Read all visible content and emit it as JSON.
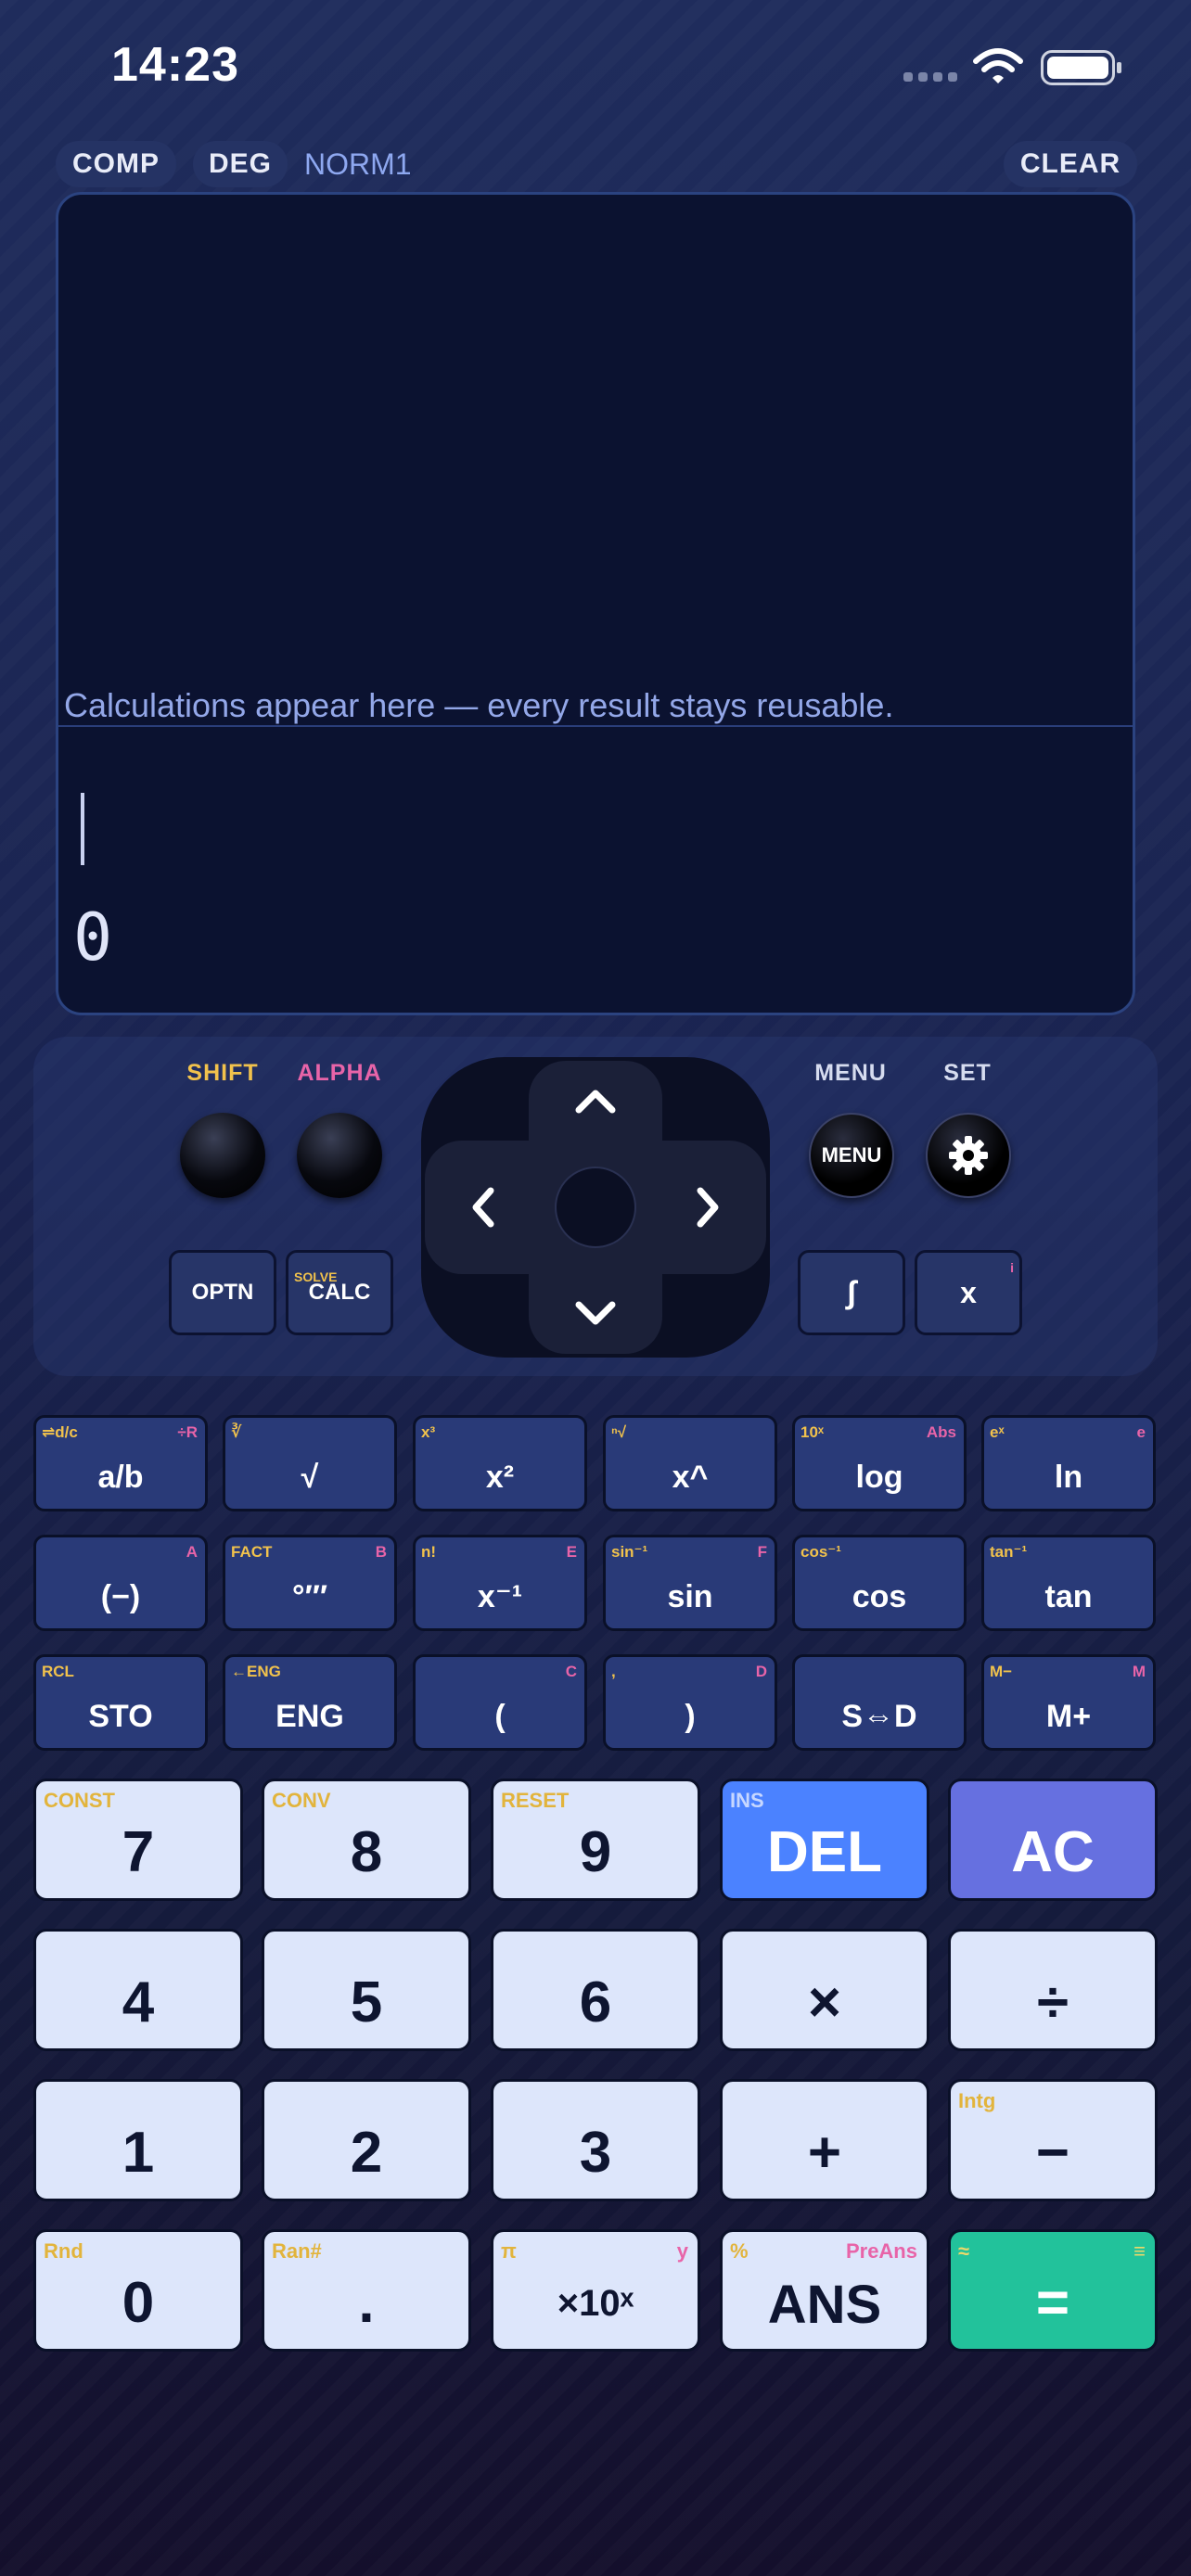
{
  "status_bar": {
    "time": "14:23"
  },
  "modes": {
    "comp": "COMP",
    "deg": "DEG",
    "norm": "NORM1",
    "clear": "CLEAR"
  },
  "display": {
    "placeholder": "Calculations appear here — every result stays reusable.",
    "result": "0"
  },
  "controls": {
    "shift_label": "SHIFT",
    "alpha_label": "ALPHA",
    "menu_label": "MENU",
    "set_label": "SET",
    "menu_button": "MENU",
    "optn": "OPTN",
    "calc": "CALC",
    "calc_shift": "SOLVE",
    "integral": "∫",
    "x": "x",
    "x_alpha": "i",
    "arrows": {
      "up": "⌃",
      "down": "⌄",
      "left": "‹",
      "right": "›"
    }
  },
  "colors": {
    "shift": "#f1c24c",
    "alpha": "#e864a8",
    "del": "#4b82ff",
    "ac": "#6670e0",
    "equals": "#22c29b"
  },
  "function_keys": [
    [
      {
        "label": "a/b",
        "shift": "⇌d/c",
        "alpha": "÷R"
      },
      {
        "label": "√",
        "shift": "∛",
        "alpha": ""
      },
      {
        "label": "x²",
        "shift": "x³",
        "alpha": ""
      },
      {
        "label": "x^",
        "shift": "ⁿ√",
        "alpha": ""
      },
      {
        "label": "log",
        "shift": "10ˣ",
        "alpha": "Abs"
      },
      {
        "label": "ln",
        "shift": "eˣ",
        "alpha": "e"
      }
    ],
    [
      {
        "label": "(−)",
        "shift": "",
        "alpha": "A"
      },
      {
        "label": "°′″",
        "shift": "FACT",
        "alpha": "B"
      },
      {
        "label": "x⁻¹",
        "shift": "n!",
        "alpha": "E"
      },
      {
        "label": "sin",
        "shift": "sin⁻¹",
        "alpha": "F"
      },
      {
        "label": "cos",
        "shift": "cos⁻¹",
        "alpha": ""
      },
      {
        "label": "tan",
        "shift": "tan⁻¹",
        "alpha": ""
      }
    ],
    [
      {
        "label": "STO",
        "shift": "RCL",
        "alpha": ""
      },
      {
        "label": "ENG",
        "shift": "←ENG",
        "alpha": ""
      },
      {
        "label": "(",
        "shift": "",
        "alpha": "C"
      },
      {
        "label": ")",
        "shift": ",",
        "alpha": "D"
      },
      {
        "label": "S⇔D",
        "shift": "",
        "alpha": ""
      },
      {
        "label": "M+",
        "shift": "M−",
        "alpha": "M"
      }
    ]
  ],
  "main_keys": [
    [
      {
        "label": "7",
        "shift": "CONST",
        "alpha": ""
      },
      {
        "label": "8",
        "shift": "CONV",
        "alpha": ""
      },
      {
        "label": "9",
        "shift": "RESET",
        "alpha": ""
      },
      {
        "label": "DEL",
        "shift": "INS",
        "alpha": ""
      },
      {
        "label": "AC",
        "shift": "",
        "alpha": ""
      }
    ],
    [
      {
        "label": "4",
        "shift": "",
        "alpha": ""
      },
      {
        "label": "5",
        "shift": "",
        "alpha": ""
      },
      {
        "label": "6",
        "shift": "",
        "alpha": ""
      },
      {
        "label": "×",
        "shift": "",
        "alpha": ""
      },
      {
        "label": "÷",
        "shift": "",
        "alpha": ""
      }
    ],
    [
      {
        "label": "1",
        "shift": "",
        "alpha": ""
      },
      {
        "label": "2",
        "shift": "",
        "alpha": ""
      },
      {
        "label": "3",
        "shift": "",
        "alpha": ""
      },
      {
        "label": "+",
        "shift": "",
        "alpha": ""
      },
      {
        "label": "−",
        "shift": "Intg",
        "alpha": ""
      }
    ],
    [
      {
        "label": "0",
        "shift": "Rnd",
        "alpha": ""
      },
      {
        "label": ".",
        "shift": "Ran#",
        "alpha": ""
      },
      {
        "label": "×10ˣ",
        "shift": "π",
        "alpha": "y"
      },
      {
        "label": "ANS",
        "shift": "%",
        "alpha": "PreAns"
      },
      {
        "label": "=",
        "shift": "≈",
        "alpha": "≡"
      }
    ]
  ]
}
